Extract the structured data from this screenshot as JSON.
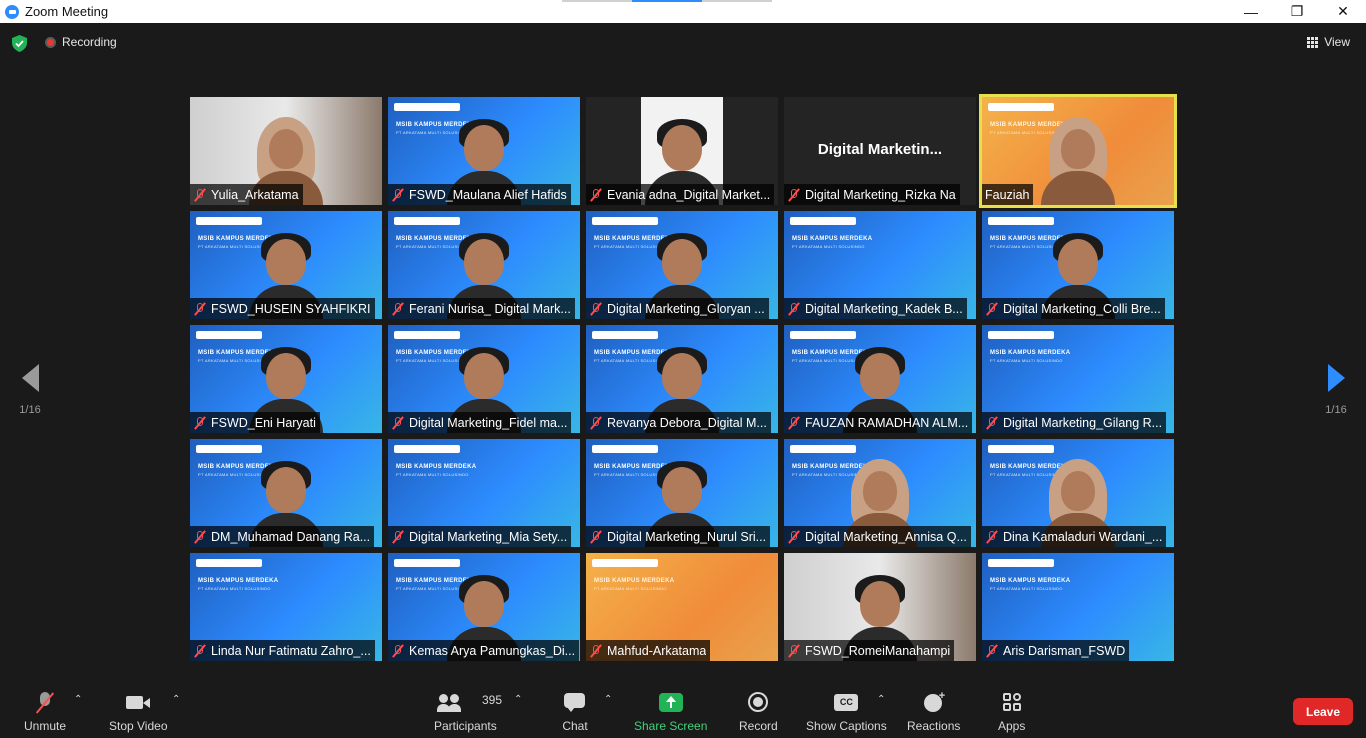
{
  "window": {
    "title": "Zoom Meeting",
    "minimize_glyph": "—",
    "maximize_glyph": "❐",
    "close_glyph": "✕"
  },
  "header": {
    "recording_label": "Recording",
    "view_label": "View"
  },
  "pager": {
    "left_count": "1/16",
    "right_count": "1/16"
  },
  "tiles": [
    {
      "name": "Yulia_Arkatama",
      "muted": true
    },
    {
      "name": "FSWD_Maulana Alief Hafids",
      "muted": true
    },
    {
      "name": "Evania adna_Digital Market...",
      "muted": true
    },
    {
      "name": "Digital Marketing_Rizka Na",
      "muted": true,
      "center_text": "Digital  Marketin..."
    },
    {
      "name": "Fauziah",
      "muted": false,
      "active_speaker": true
    },
    {
      "name": "FSWD_HUSEIN SYAHFIKRI",
      "muted": true
    },
    {
      "name": "Ferani Nurisa_ Digital Mark...",
      "muted": true
    },
    {
      "name": "Digital Marketing_Gloryan ...",
      "muted": true
    },
    {
      "name": "Digital Marketing_Kadek B...",
      "muted": true
    },
    {
      "name": "Digital Marketing_Colli Bre...",
      "muted": true
    },
    {
      "name": "FSWD_Eni Haryati",
      "muted": true
    },
    {
      "name": "Digital Marketing_Fidel ma...",
      "muted": true
    },
    {
      "name": "Revanya Debora_Digital M...",
      "muted": true
    },
    {
      "name": "FAUZAN RAMADHAN ALM...",
      "muted": true
    },
    {
      "name": "Digital Marketing_Gilang R...",
      "muted": true
    },
    {
      "name": "DM_Muhamad Danang Ra...",
      "muted": true
    },
    {
      "name": "Digital Marketing_Mia Sety...",
      "muted": true
    },
    {
      "name": "Digital Marketing_Nurul Sri...",
      "muted": true
    },
    {
      "name": "Digital Marketing_Annisa Q...",
      "muted": true
    },
    {
      "name": "Dina Kamaladuri Wardani_...",
      "muted": true
    },
    {
      "name": "Linda Nur Fatimatu Zahro_...",
      "muted": true
    },
    {
      "name": "Kemas Arya Pamungkas_Di...",
      "muted": true
    },
    {
      "name": "Mahfud-Arkatama",
      "muted": true
    },
    {
      "name": "FSWD_RomeiManahampi",
      "muted": true
    },
    {
      "name": "Aris Darisman_FSWD",
      "muted": true
    }
  ],
  "backgrounds": {
    "banner_title": "MSIB KAMPUS MERDEKA",
    "banner_subtitle": "PT ARKATAMA MULTI SOLUSINDO"
  },
  "toolbar": {
    "unmute_label": "Unmute",
    "stop_video_label": "Stop Video",
    "participants_label": "Participants",
    "participants_count": "395",
    "chat_label": "Chat",
    "share_screen_label": "Share Screen",
    "record_label": "Record",
    "show_captions_label": "Show Captions",
    "captions_icon_text": "CC",
    "reactions_label": "Reactions",
    "apps_label": "Apps",
    "leave_label": "Leave"
  },
  "colors": {
    "accent_blue": "#2d8cff",
    "share_green": "#22b357",
    "leave_red": "#e02828",
    "speaker_outline": "#e6e04a"
  }
}
